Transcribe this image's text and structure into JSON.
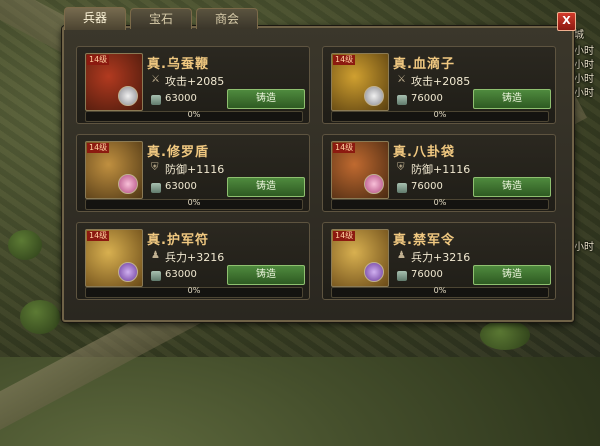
{
  "tabs": [
    "兵器",
    "宝石",
    "商会"
  ],
  "close_label": "X",
  "side_labels": [
    "城",
    "小时",
    "小时",
    "小时",
    "小时",
    "小时"
  ],
  "cards": [
    {
      "name": "真.乌蚕鞭",
      "stat": "攻击+2085",
      "stat_icon": "sword-icon",
      "cost": "63000",
      "forge_label": "铸造",
      "progress": "0%",
      "progress_value": 0,
      "level_badge": "14级"
    },
    {
      "name": "真.血滴子",
      "stat": "攻击+2085",
      "stat_icon": "sword-icon",
      "cost": "76000",
      "forge_label": "铸造",
      "progress": "0%",
      "progress_value": 0,
      "level_badge": "14级"
    },
    {
      "name": "真.修罗盾",
      "stat": "防御+1116",
      "stat_icon": "shield-icon",
      "cost": "63000",
      "forge_label": "铸造",
      "progress": "0%",
      "progress_value": 0,
      "level_badge": "14级"
    },
    {
      "name": "真.八卦袋",
      "stat": "防御+1116",
      "stat_icon": "shield-icon",
      "cost": "76000",
      "forge_label": "铸造",
      "progress": "0%",
      "progress_value": 0,
      "level_badge": "14级"
    },
    {
      "name": "真.护军符",
      "stat": "兵力+3216",
      "stat_icon": "soldier-icon",
      "cost": "63000",
      "forge_label": "铸造",
      "progress": "0%",
      "progress_value": 0,
      "level_badge": "14级"
    },
    {
      "name": "真.禁军令",
      "stat": "兵力+3216",
      "stat_icon": "soldier-icon",
      "cost": "76000",
      "forge_label": "铸造",
      "progress": "0%",
      "progress_value": 0,
      "level_badge": "14级"
    }
  ],
  "colors": {
    "accent": "#f0c880",
    "forge_button": "#4f8a3e",
    "level_badge": "#8c1a10"
  }
}
